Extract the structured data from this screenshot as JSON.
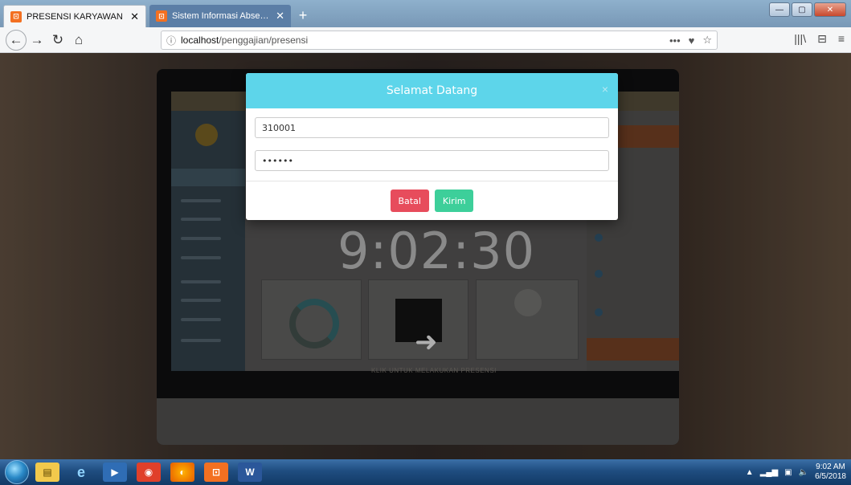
{
  "browser": {
    "tabs": [
      {
        "title": "PRESENSI KARYAWAN",
        "active": true
      },
      {
        "title": "Sistem Informasi Absensi & Pe",
        "active": false
      }
    ],
    "url_host": "localhost",
    "url_path": "/penggajian/presensi",
    "page_actions_glyph": "•••",
    "bookmark_glyph": "☆",
    "pocket_glyph": "♥",
    "library_glyph": "|||\\",
    "sidebar_glyph": "⊟",
    "menu_glyph": "≡"
  },
  "page": {
    "clock": "9:02:30",
    "footer_text": "KLIK UNTUK MELAKUKAN PRESENSI"
  },
  "modal": {
    "title": "Selamat Datang",
    "close_glyph": "×",
    "username_value": "310001",
    "password_value": "••••••",
    "cancel_label": "Batal",
    "submit_label": "Kirim"
  },
  "taskbar": {
    "time": "9:02 AM",
    "date": "6/5/2018"
  },
  "colors": {
    "modal_header": "#5dd5ea",
    "cancel_button": "#e74c5c",
    "submit_button": "#3dcf9a"
  },
  "icons": [
    "favicon-icon",
    "close-icon",
    "back-icon",
    "forward-icon",
    "reload-icon",
    "home-icon",
    "info-icon",
    "search-icon",
    "start-orb-icon",
    "explorer-icon",
    "ie-icon",
    "media-icon",
    "xampp-icon",
    "firefox-icon",
    "word-icon"
  ]
}
